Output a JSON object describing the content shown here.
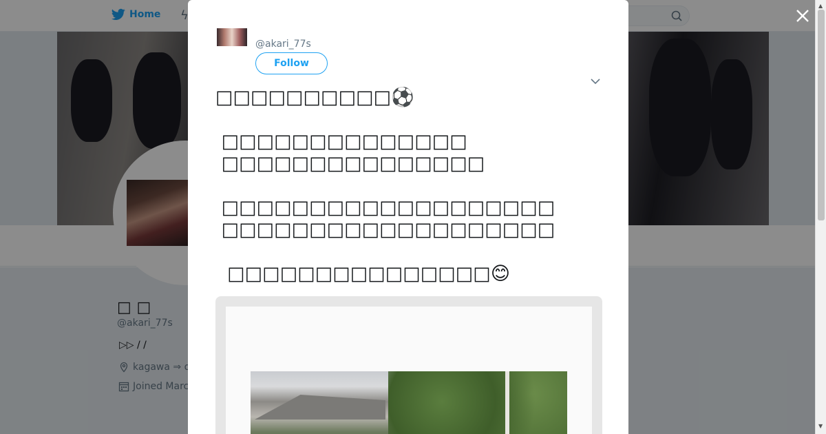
{
  "nav": {
    "home_label": "Home"
  },
  "profile": {
    "name": "□ □",
    "handle": "@akari_77s",
    "bio": "▷▷ / /",
    "location": "kagawa ⇒ o",
    "joined": "Joined March"
  },
  "tweet": {
    "handle": "@akari_77s",
    "follow_label": "Follow",
    "text": "□□□□□□□□□□⚽\n\n □□□□□□□□□□□□□□\n □□□□□□□□□□□□□□□\n\n □□□□□□□□□□□□□□□□□□□\n □□□□□□□□□□□□□□□□□□□\n\n  □□□□□□□□□□□□□□□😊"
  },
  "colors": {
    "accent": "#1da1f2",
    "overlay": "rgba(0,0,0,0.45)"
  },
  "icons": {
    "home": "bird-icon",
    "search": "search-icon",
    "close": "close-icon",
    "caret": "chevron-down-icon",
    "location": "location-pin-icon",
    "calendar": "calendar-icon"
  }
}
